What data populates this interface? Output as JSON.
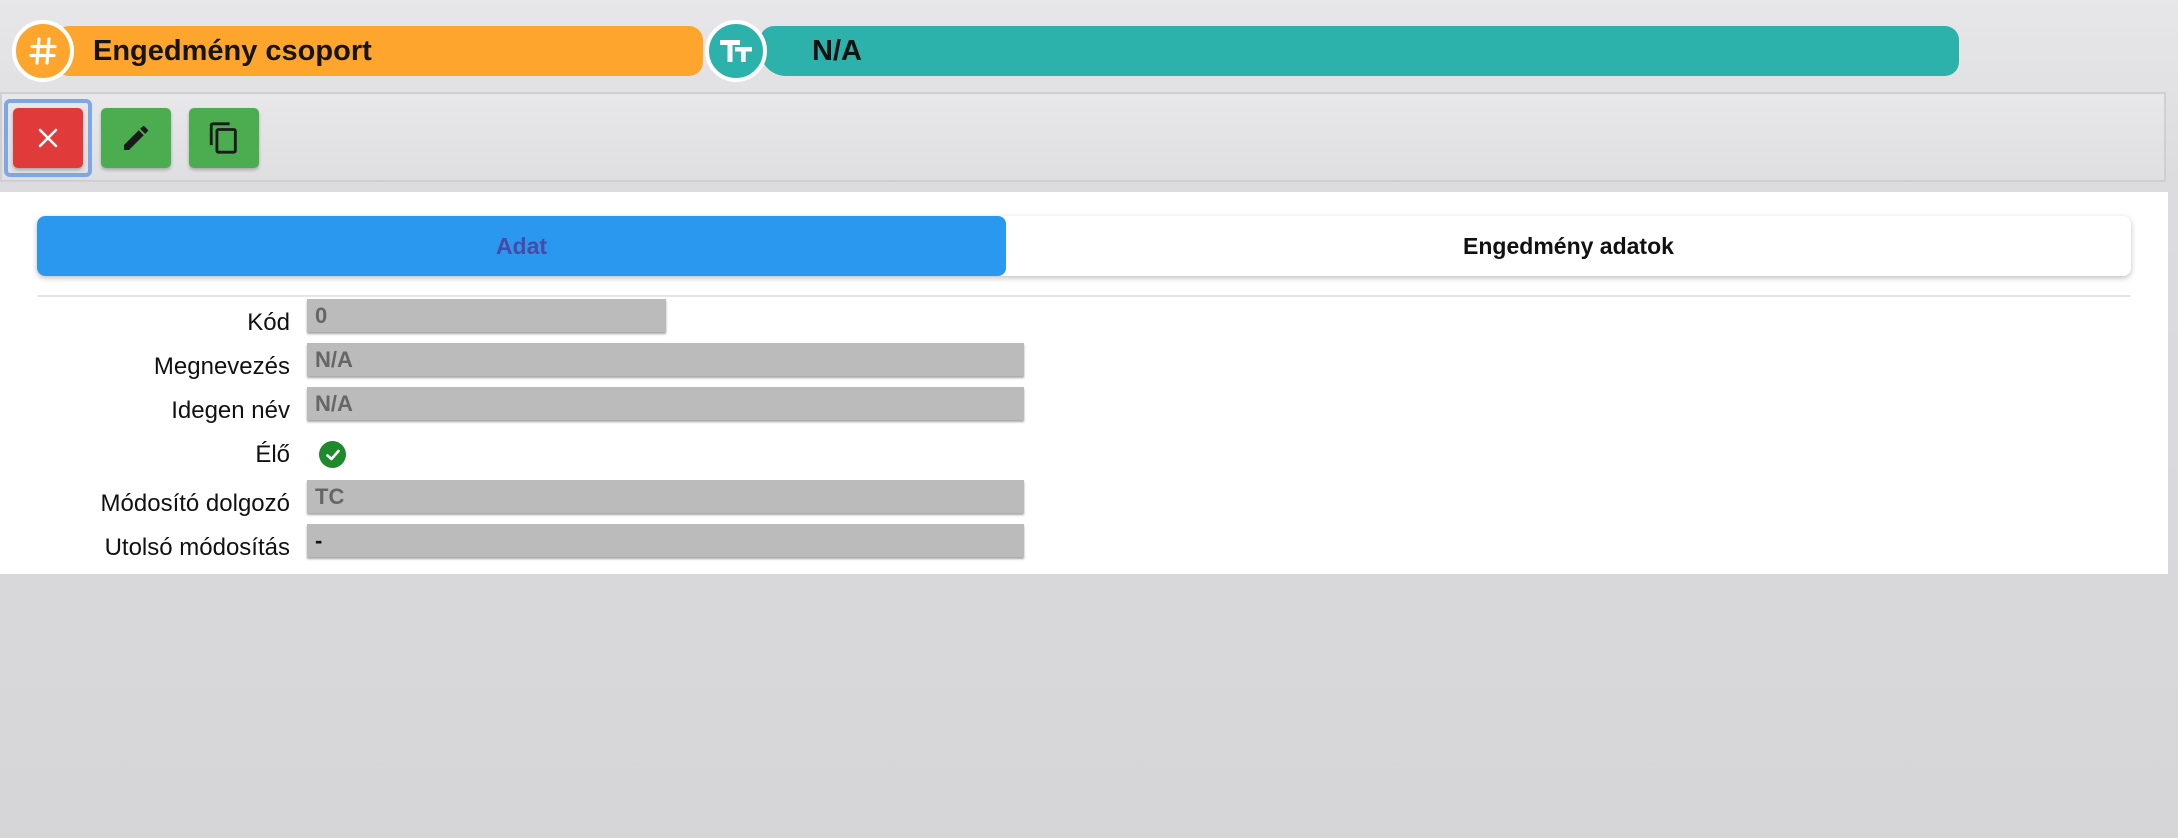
{
  "header": {
    "title": "Engedmény csoport",
    "name_value": "N/A",
    "title_icon": "hash-icon",
    "name_icon": "text-type-icon"
  },
  "toolbar": {
    "buttons": [
      {
        "name": "close",
        "icon": "close-icon"
      },
      {
        "name": "edit",
        "icon": "pencil-icon"
      },
      {
        "name": "copy",
        "icon": "copy-icon"
      }
    ]
  },
  "tabs": [
    {
      "label": "Adat",
      "active": true
    },
    {
      "label": "Engedmény adatok",
      "active": false
    }
  ],
  "form": {
    "kod": {
      "label": "Kód",
      "value": "0"
    },
    "megnevezes": {
      "label": "Megnevezés",
      "value": "N/A"
    },
    "idegen_nev": {
      "label": "Idegen név",
      "value": "N/A"
    },
    "elo": {
      "label": "Élő",
      "checked": true
    },
    "modosito": {
      "label": "Módosító dolgozó",
      "value": "TC"
    },
    "utolso": {
      "label": "Utolsó módosítás",
      "value": "-"
    }
  },
  "colors": {
    "title_pill": "#fea52d",
    "name_pill": "#2cb2aa",
    "close_button": "#e03a3a",
    "action_button": "#4cad50",
    "active_tab": "#2b98ef",
    "field_bg": "#bbbbbb",
    "check": "#1f8a2c"
  }
}
